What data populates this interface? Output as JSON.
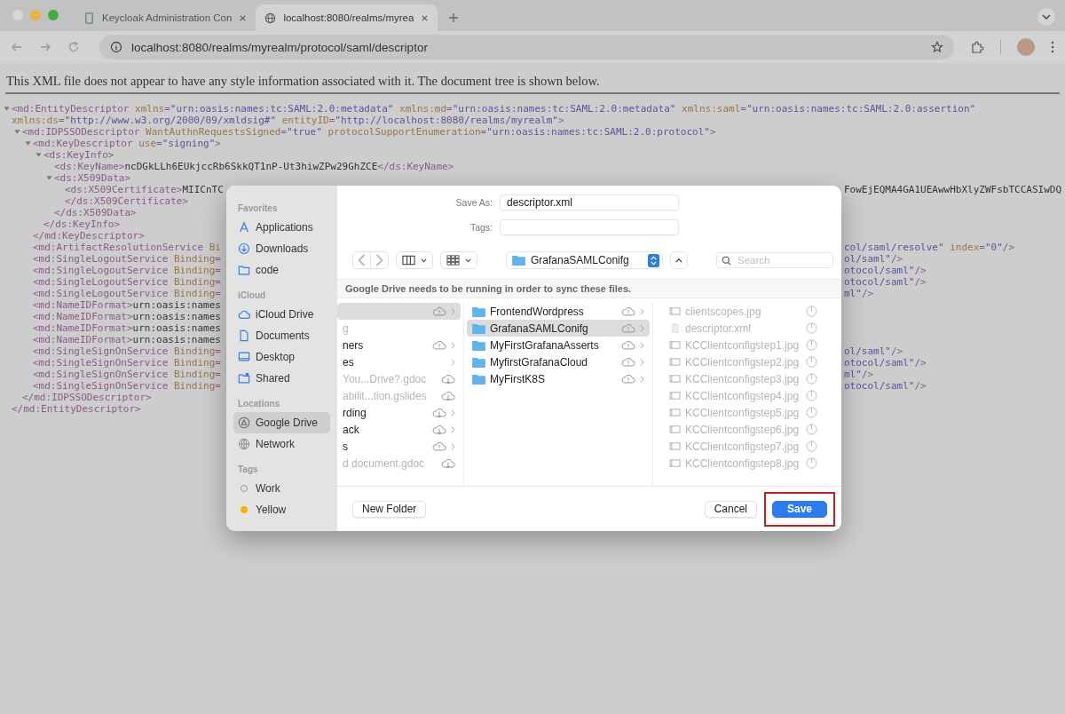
{
  "browser": {
    "tabs": [
      {
        "title": "Keycloak Administration Con",
        "selected": false
      },
      {
        "title": "localhost:8080/realms/myrea",
        "selected": true
      }
    ],
    "address": "localhost:8080/realms/myrealm/protocol/saml/descriptor"
  },
  "page": {
    "notice": "This XML file does not appear to have any style information associated with it. The document tree is shown below.",
    "xml_tree": [
      {
        "expanded": true,
        "open": [
          {
            "kind": "tag",
            "text": "<md:EntityDescriptor"
          },
          {
            "kind": "attr",
            "text": " xmlns"
          },
          {
            "kind": "tag",
            "text": "="
          },
          {
            "kind": "value",
            "text": "\"urn:oasis:names:tc:SAML:2.0:metadata\""
          },
          {
            "kind": "attr",
            "text": " xmlns:md"
          },
          {
            "kind": "tag",
            "text": "="
          },
          {
            "kind": "value",
            "text": "\"urn:oasis:names:tc:SAML:2.0:metadata\""
          },
          {
            "kind": "attr",
            "text": " xmlns:saml"
          },
          {
            "kind": "tag",
            "text": "="
          },
          {
            "kind": "value",
            "text": "\"urn:oasis:names:tc:SAML:2.0:assertion\""
          },
          {
            "kind": "attr",
            "text": " xmlns:ds"
          },
          {
            "kind": "tag",
            "text": "="
          },
          {
            "kind": "value",
            "text": "\"http://www.w3.org/2000/09/xmldsig#\""
          },
          {
            "kind": "attr",
            "text": " entityID"
          },
          {
            "kind": "tag",
            "text": "="
          },
          {
            "kind": "value",
            "text": "\"http://localhost:8080/realms/myrealm\""
          },
          {
            "kind": "tag",
            "text": ">"
          }
        ],
        "children": [
          {
            "expanded": true,
            "open": [
              {
                "kind": "tag",
                "text": "<md:IDPSSODescriptor"
              },
              {
                "kind": "attr",
                "text": " WantAuthnRequestsSigned"
              },
              {
                "kind": "tag",
                "text": "="
              },
              {
                "kind": "value",
                "text": "\"true\""
              },
              {
                "kind": "attr",
                "text": " protocolSupportEnumeration"
              },
              {
                "kind": "tag",
                "text": "="
              },
              {
                "kind": "value",
                "text": "\"urn:oasis:names:tc:SAML:2.0:protocol\""
              },
              {
                "kind": "tag",
                "text": ">"
              }
            ],
            "children": [
              {
                "expanded": true,
                "open": [
                  {
                    "kind": "tag",
                    "text": "<md:KeyDescriptor"
                  },
                  {
                    "kind": "attr",
                    "text": " use"
                  },
                  {
                    "kind": "tag",
                    "text": "="
                  },
                  {
                    "kind": "value",
                    "text": "\"signing\""
                  },
                  {
                    "kind": "tag",
                    "text": ">"
                  }
                ],
                "children": [
                  {
                    "expanded": true,
                    "open": [
                      {
                        "kind": "tag",
                        "text": "<ds:KeyInfo>"
                      }
                    ],
                    "children": [
                      {
                        "open": [
                          {
                            "kind": "tag",
                            "text": "<ds:KeyName>"
                          },
                          {
                            "kind": "text",
                            "text": "ncDGkLLh6EUkjccRb6SkkQT1nP-Ut3hiwZPw29GhZCE"
                          },
                          {
                            "kind": "tag",
                            "text": "</ds:KeyName>"
                          }
                        ]
                      },
                      {
                        "expanded": true,
                        "open": [
                          {
                            "kind": "tag",
                            "text": "<ds:X509Data>"
                          }
                        ],
                        "children": [
                          {
                            "open": [
                              {
                                "kind": "tag",
                                "text": "<ds:X509Certificate>"
                              },
                              {
                                "kind": "text",
                                "text": "MIICnTC"
                              }
                            ],
                            "right": [
                              {
                                "kind": "text",
                                "text": "FowEjEQMA4GA1UEAwwHbXlyZWFsbTCCASIwDQ"
                              }
                            ],
                            "close": [
                              {
                                "kind": "tag",
                                "text": "</ds:X509Certificate>"
                              }
                            ]
                          }
                        ],
                        "close": [
                          {
                            "kind": "tag",
                            "text": "</ds:X509Data>"
                          }
                        ]
                      }
                    ],
                    "close": [
                      {
                        "kind": "tag",
                        "text": "</ds:KeyInfo>"
                      }
                    ]
                  }
                ],
                "close": [
                  {
                    "kind": "tag",
                    "text": "</md:KeyDescriptor>"
                  }
                ]
              },
              {
                "open": [
                  {
                    "kind": "tag",
                    "text": "<md:ArtifactResolutionService"
                  },
                  {
                    "kind": "attr",
                    "text": " Bi"
                  }
                ],
                "right": [
                  {
                    "kind": "value",
                    "text": "col/saml/resolve\""
                  },
                  {
                    "kind": "attr",
                    "text": " index"
                  },
                  {
                    "kind": "tag",
                    "text": "="
                  },
                  {
                    "kind": "value",
                    "text": "\"0\""
                  },
                  {
                    "kind": "tag",
                    "text": "/>"
                  }
                ]
              },
              {
                "open": [
                  {
                    "kind": "tag",
                    "text": "<md:SingleLogoutService"
                  },
                  {
                    "kind": "attr",
                    "text": " Binding"
                  },
                  {
                    "kind": "tag",
                    "text": "="
                  }
                ],
                "right": [
                  {
                    "kind": "value",
                    "text": "ol/saml\""
                  },
                  {
                    "kind": "tag",
                    "text": "/>"
                  }
                ]
              },
              {
                "open": [
                  {
                    "kind": "tag",
                    "text": "<md:SingleLogoutService"
                  },
                  {
                    "kind": "attr",
                    "text": " Binding"
                  },
                  {
                    "kind": "tag",
                    "text": "="
                  }
                ],
                "right": [
                  {
                    "kind": "value",
                    "text": "otocol/saml\""
                  },
                  {
                    "kind": "tag",
                    "text": "/>"
                  }
                ]
              },
              {
                "open": [
                  {
                    "kind": "tag",
                    "text": "<md:SingleLogoutService"
                  },
                  {
                    "kind": "attr",
                    "text": " Binding"
                  },
                  {
                    "kind": "tag",
                    "text": "="
                  }
                ],
                "right": [
                  {
                    "kind": "value",
                    "text": "otocol/saml\""
                  },
                  {
                    "kind": "tag",
                    "text": "/>"
                  }
                ]
              },
              {
                "open": [
                  {
                    "kind": "tag",
                    "text": "<md:SingleLogoutService"
                  },
                  {
                    "kind": "attr",
                    "text": " Binding"
                  },
                  {
                    "kind": "tag",
                    "text": "="
                  }
                ],
                "right": [
                  {
                    "kind": "value",
                    "text": "ml\""
                  },
                  {
                    "kind": "tag",
                    "text": "/>"
                  }
                ]
              },
              {
                "open": [
                  {
                    "kind": "tag",
                    "text": "<md:NameIDFormat>"
                  },
                  {
                    "kind": "text",
                    "text": "urn:oasis:names"
                  }
                ]
              },
              {
                "open": [
                  {
                    "kind": "tag",
                    "text": "<md:NameIDFormat>"
                  },
                  {
                    "kind": "text",
                    "text": "urn:oasis:names"
                  }
                ]
              },
              {
                "open": [
                  {
                    "kind": "tag",
                    "text": "<md:NameIDFormat>"
                  },
                  {
                    "kind": "text",
                    "text": "urn:oasis:names"
                  }
                ]
              },
              {
                "open": [
                  {
                    "kind": "tag",
                    "text": "<md:NameIDFormat>"
                  },
                  {
                    "kind": "text",
                    "text": "urn:oasis:names"
                  }
                ]
              },
              {
                "open": [
                  {
                    "kind": "tag",
                    "text": "<md:SingleSignOnService"
                  },
                  {
                    "kind": "attr",
                    "text": " Binding"
                  },
                  {
                    "kind": "tag",
                    "text": "="
                  }
                ],
                "right": [
                  {
                    "kind": "value",
                    "text": "ol/saml\""
                  },
                  {
                    "kind": "tag",
                    "text": "/>"
                  }
                ]
              },
              {
                "open": [
                  {
                    "kind": "tag",
                    "text": "<md:SingleSignOnService"
                  },
                  {
                    "kind": "attr",
                    "text": " Binding"
                  },
                  {
                    "kind": "tag",
                    "text": "="
                  }
                ],
                "right": [
                  {
                    "kind": "value",
                    "text": "otocol/saml\""
                  },
                  {
                    "kind": "tag",
                    "text": "/>"
                  }
                ]
              },
              {
                "open": [
                  {
                    "kind": "tag",
                    "text": "<md:SingleSignOnService"
                  },
                  {
                    "kind": "attr",
                    "text": " Binding"
                  },
                  {
                    "kind": "tag",
                    "text": "="
                  }
                ],
                "right": [
                  {
                    "kind": "value",
                    "text": "ml\""
                  },
                  {
                    "kind": "tag",
                    "text": "/>"
                  }
                ]
              },
              {
                "open": [
                  {
                    "kind": "tag",
                    "text": "<md:SingleSignOnService"
                  },
                  {
                    "kind": "attr",
                    "text": " Binding"
                  },
                  {
                    "kind": "tag",
                    "text": "="
                  }
                ],
                "right": [
                  {
                    "kind": "value",
                    "text": "otocol/saml\""
                  },
                  {
                    "kind": "tag",
                    "text": "/>"
                  }
                ]
              }
            ],
            "close": [
              {
                "kind": "tag",
                "text": "</md:IDPSSODescriptor>"
              }
            ]
          }
        ],
        "close": [
          {
            "kind": "tag",
            "text": "</md:EntityDescriptor>"
          }
        ]
      }
    ]
  },
  "dialog": {
    "sidebar": [
      {
        "heading": "Favorites",
        "items": [
          {
            "label": "Applications",
            "selected": false
          },
          {
            "label": "Downloads",
            "selected": false
          },
          {
            "label": "code",
            "selected": false
          }
        ]
      },
      {
        "heading": "iCloud",
        "items": [
          {
            "label": "iCloud Drive",
            "selected": false
          },
          {
            "label": "Documents",
            "selected": false
          },
          {
            "label": "Desktop",
            "selected": false
          },
          {
            "label": "Shared",
            "selected": false
          }
        ]
      },
      {
        "heading": "Locations",
        "items": [
          {
            "label": "Google Drive",
            "selected": true
          },
          {
            "label": "Network",
            "selected": false
          }
        ]
      }
    ],
    "tags": {
      "heading": "Tags",
      "items": [
        {
          "label": "Work",
          "kind": "ring",
          "color": "#9b9b9b"
        },
        {
          "label": "Yellow",
          "kind": "dot",
          "color": "#f4b400"
        }
      ]
    },
    "save_as": {
      "label": "Save As:",
      "value": "descriptor.xml"
    },
    "tags_field": {
      "label": "Tags:"
    },
    "location": "GrafanaSAMLConifg",
    "search": {
      "placeholder": "Search"
    },
    "banner": "Google Drive needs to be running in order to sync these files.",
    "column_1": [
      {
        "selected": true,
        "disabled": false,
        "kind": "alert",
        "chevron": true
      },
      {
        "label": "g",
        "selected": false,
        "disabled": true,
        "kind": "plain",
        "chevron": false
      },
      {
        "label": "ners",
        "selected": false,
        "disabled": false,
        "kind": "alert",
        "chevron": true
      },
      {
        "label": "es",
        "selected": false,
        "disabled": false,
        "kind": "plain",
        "chevron": true
      },
      {
        "label": "You...Drive?.gdoc",
        "selected": false,
        "disabled": true,
        "kind": "download",
        "chevron": false
      },
      {
        "label": "abilit...tion.gslides",
        "selected": false,
        "disabled": true,
        "kind": "download",
        "chevron": false
      },
      {
        "label": "rding",
        "selected": false,
        "disabled": false,
        "kind": "download",
        "chevron": true
      },
      {
        "label": "ack",
        "selected": false,
        "disabled": false,
        "kind": "download",
        "chevron": true
      },
      {
        "label": "s",
        "selected": false,
        "disabled": false,
        "kind": "alert",
        "chevron": true
      },
      {
        "label": "d document.gdoc",
        "selected": false,
        "disabled": true,
        "kind": "download",
        "chevron": false
      }
    ],
    "column_2": [
      {
        "label": "FrontendWordpress",
        "selected": false
      },
      {
        "label": "GrafanaSAMLConifg",
        "selected": true
      },
      {
        "label": "MyFirstGrafanaAsserts",
        "selected": false
      },
      {
        "label": "MyfirstGrafanaCloud",
        "selected": false
      },
      {
        "label": "MyFirstK8S",
        "selected": false
      }
    ],
    "column_3": [
      {
        "label": "clientscopes.jpg",
        "kind": "image"
      },
      {
        "label": "descriptor.xml",
        "kind": "document"
      },
      {
        "label": "KCClientconfigstep1.jpg",
        "kind": "image"
      },
      {
        "label": "KCClientconfigstep2.jpg",
        "kind": "image"
      },
      {
        "label": "KCClientconfigstep3.jpg",
        "kind": "image"
      },
      {
        "label": "KCClientconfigstep4.jpg",
        "kind": "image"
      },
      {
        "label": "KCClientconfigstep5.jpg",
        "kind": "image"
      },
      {
        "label": "KCClientconfigstep6.jpg",
        "kind": "image"
      },
      {
        "label": "KCClientconfigstep7.jpg",
        "kind": "image"
      },
      {
        "label": "KCClientconfigstep8.jpg",
        "kind": "image"
      }
    ],
    "buttons": {
      "new_folder": "New Folder",
      "cancel": "Cancel",
      "save": "Save"
    }
  }
}
